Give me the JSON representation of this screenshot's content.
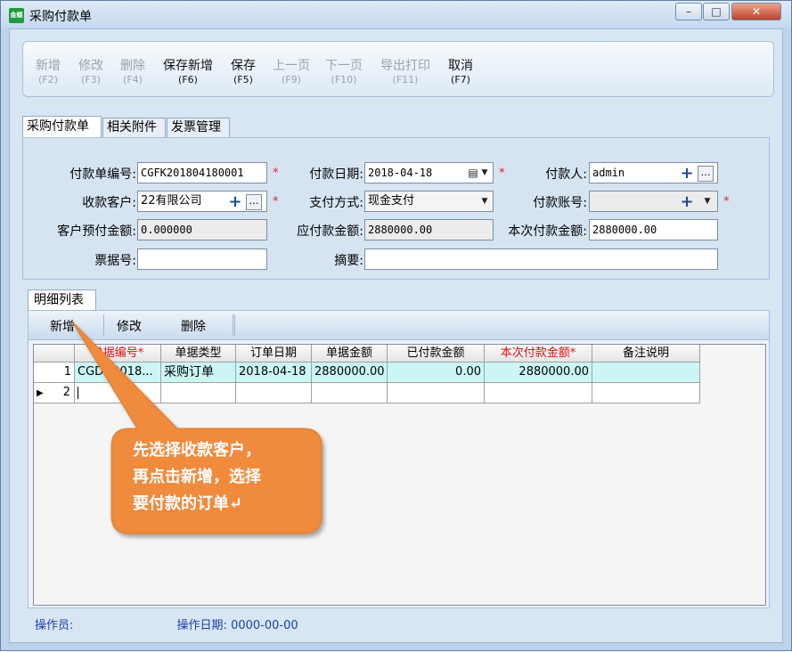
{
  "window": {
    "title": "采购付款单",
    "icon_text": "金蝶"
  },
  "toolbar": {
    "buttons": [
      {
        "label": "新增",
        "key": "(F2)",
        "enabled": false
      },
      {
        "label": "修改",
        "key": "(F3)",
        "enabled": false
      },
      {
        "label": "删除",
        "key": "(F4)",
        "enabled": false
      },
      {
        "label": "保存新增",
        "key": "(F6)",
        "enabled": true
      },
      {
        "label": "保存",
        "key": "(F5)",
        "enabled": true
      },
      {
        "label": "上一页",
        "key": "(F9)",
        "enabled": false
      },
      {
        "label": "下一页",
        "key": "(F10)",
        "enabled": false
      },
      {
        "label": "导出打印",
        "key": "(F11)",
        "enabled": false
      },
      {
        "label": "取消",
        "key": "(F7)",
        "enabled": true
      }
    ]
  },
  "tabs": [
    "采购付款单",
    "相关附件",
    "发票管理"
  ],
  "form": {
    "payment_no_label": "付款单编号:",
    "payment_no": "CGFK201804180001",
    "payment_date_label": "付款日期:",
    "payment_date": "2018-04-18",
    "payer_label": "付款人:",
    "payer": "admin",
    "customer_label": "收款客户:",
    "customer": "22有限公司",
    "pay_method_label": "支付方式:",
    "pay_method": "现金支付",
    "pay_account_label": "付款账号:",
    "pay_account": "",
    "prepaid_label": "客户预付金额:",
    "prepaid": "0.000000",
    "payable_label": "应付款金额:",
    "payable": "2880000.00",
    "this_pay_label": "本次付款金额:",
    "this_pay": "2880000.00",
    "bill_no_label": "票据号:",
    "bill_no": "",
    "summary_label": "摘要:",
    "summary": "",
    "required_mark": "*"
  },
  "detail": {
    "tab_label": "明细列表",
    "buttons": [
      "新增",
      "修改",
      "删除"
    ],
    "columns": [
      "单据编号*",
      "单据类型",
      "订单日期",
      "单据金额",
      "已付款金额",
      "本次付款金额*",
      "备注说明"
    ],
    "rows": [
      {
        "idx": "1",
        "cells": [
          "CGDD2018...",
          "采购订单",
          "2018-04-18",
          "2880000.00",
          "0.00",
          "2880000.00",
          ""
        ]
      },
      {
        "idx": "2",
        "cells": [
          "",
          "",
          "",
          "",
          "",
          "",
          ""
        ]
      }
    ],
    "current_row_marker": "▶"
  },
  "callout": {
    "lines": [
      "先选择收款客户，",
      "再点击新增，选择",
      "要付款的订单↵"
    ],
    "color": "#f08a3c"
  },
  "status": {
    "operator_label": "操作员:",
    "operator": "",
    "date_label": "操作日期:",
    "date": "0000-00-00"
  }
}
